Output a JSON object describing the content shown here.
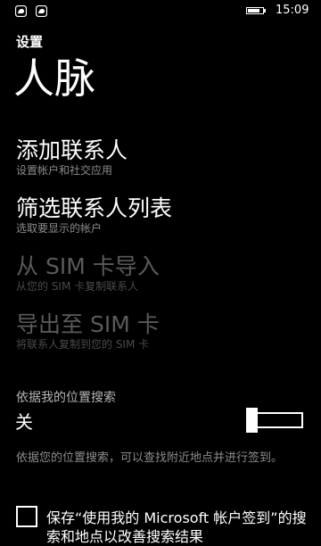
{
  "status_bar": {
    "notifications": [
      "notification-icon",
      "notification-icon"
    ],
    "time": "15:09",
    "battery_icon": "battery-icon"
  },
  "header": {
    "app_title": "设置",
    "page_title": "人脉"
  },
  "menu": [
    {
      "title": "添加联系人",
      "subtitle": "设置帐户和社交应用",
      "enabled": true
    },
    {
      "title": "筛选联系人列表",
      "subtitle": "选取要显示的帐户",
      "enabled": true
    },
    {
      "title": "从 SIM 卡导入",
      "subtitle": "从您的 SIM 卡复制联系人",
      "enabled": false
    },
    {
      "title": "导出至 SIM 卡",
      "subtitle": "将联系人复制到您的 SIM 卡",
      "enabled": false
    }
  ],
  "location_search": {
    "label": "依据我的位置搜索",
    "state": "关",
    "on": false,
    "description": "依据您的位置搜索，可以查找附近地点并进行签到。"
  },
  "checkin_option": {
    "checked": false,
    "label": "保存“使用我的 Microsoft 帐户签到”的搜索和地点以改善搜索结果"
  },
  "colors": {
    "background": "#000000",
    "foreground": "#ffffff",
    "subtle_text": "#8c8c8c",
    "disabled_text": "#5a5a5a"
  }
}
